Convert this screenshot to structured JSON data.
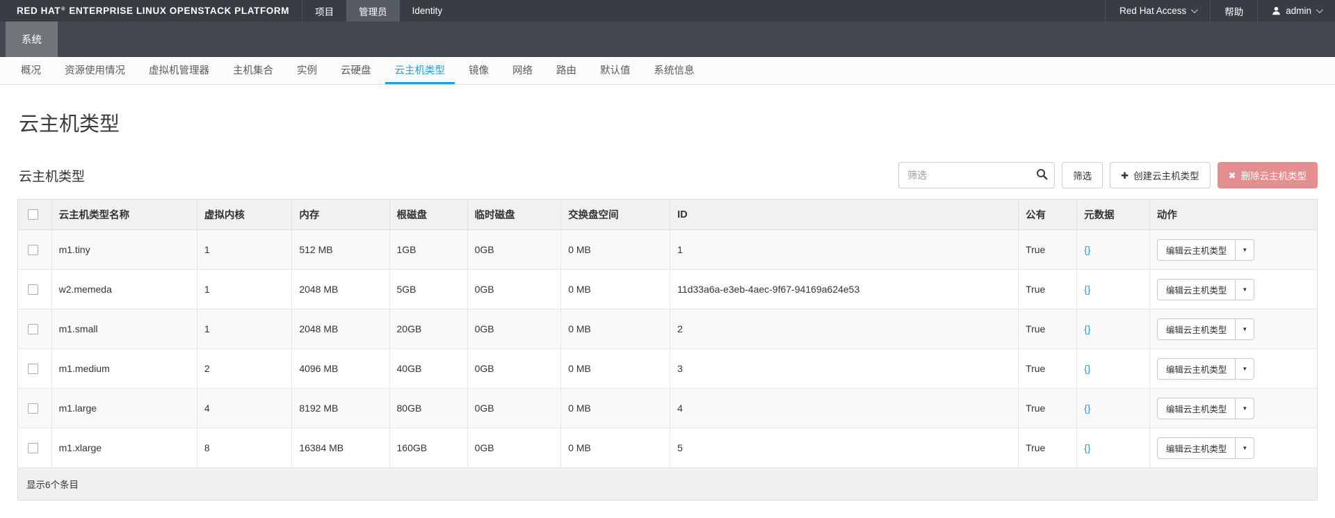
{
  "navbar": {
    "brand": {
      "name": "RED HAT",
      "reg": "®",
      "suffix": "ENTERPRISE LINUX OPENSTACK PLATFORM"
    },
    "tabs": [
      {
        "label": "项目",
        "active": false
      },
      {
        "label": "管理员",
        "active": true
      },
      {
        "label": "Identity",
        "active": false
      }
    ],
    "right": {
      "access_label": "Red Hat Access",
      "help_label": "帮助",
      "user_label": "admin"
    }
  },
  "context_bar": {
    "tab_label": "系统"
  },
  "subtabs": {
    "items": [
      "概况",
      "资源使用情况",
      "虚拟机管理器",
      "主机集合",
      "实例",
      "云硬盘",
      "云主机类型",
      "镜像",
      "网络",
      "路由",
      "默认值",
      "系统信息"
    ],
    "active_index": 6
  },
  "page": {
    "title": "云主机类型"
  },
  "toolbar": {
    "section_title": "云主机类型",
    "filter_placeholder": "筛选",
    "filter_value": "",
    "filter_button_label": "筛选",
    "create_button_label": "创建云主机类型",
    "delete_button_label": "删除云主机类型"
  },
  "icons": {
    "plus": "✚",
    "close": "✖",
    "caret_down": "▼",
    "search": "magnifier",
    "user": "person-silhouette"
  },
  "table": {
    "headers": [
      "云主机类型名称",
      "虚拟内核",
      "内存",
      "根磁盘",
      "临时磁盘",
      "交换盘空间",
      "ID",
      "公有",
      "元数据",
      "动作"
    ],
    "rows": [
      {
        "name": "m1.tiny",
        "vcpus": "1",
        "ram": "512 MB",
        "root_disk": "1GB",
        "ephemeral_disk": "0GB",
        "swap": "0 MB",
        "id": "1",
        "public": "True",
        "metadata": "{}",
        "action": "编辑云主机类型"
      },
      {
        "name": "w2.memeda",
        "vcpus": "1",
        "ram": "2048 MB",
        "root_disk": "5GB",
        "ephemeral_disk": "0GB",
        "swap": "0 MB",
        "id": "11d33a6a-e3eb-4aec-9f67-94169a624e53",
        "public": "True",
        "metadata": "{}",
        "action": "编辑云主机类型"
      },
      {
        "name": "m1.small",
        "vcpus": "1",
        "ram": "2048 MB",
        "root_disk": "20GB",
        "ephemeral_disk": "0GB",
        "swap": "0 MB",
        "id": "2",
        "public": "True",
        "metadata": "{}",
        "action": "编辑云主机类型"
      },
      {
        "name": "m1.medium",
        "vcpus": "2",
        "ram": "4096 MB",
        "root_disk": "40GB",
        "ephemeral_disk": "0GB",
        "swap": "0 MB",
        "id": "3",
        "public": "True",
        "metadata": "{}",
        "action": "编辑云主机类型"
      },
      {
        "name": "m1.large",
        "vcpus": "4",
        "ram": "8192 MB",
        "root_disk": "80GB",
        "ephemeral_disk": "0GB",
        "swap": "0 MB",
        "id": "4",
        "public": "True",
        "metadata": "{}",
        "action": "编辑云主机类型"
      },
      {
        "name": "m1.xlarge",
        "vcpus": "8",
        "ram": "16384 MB",
        "root_disk": "160GB",
        "ephemeral_disk": "0GB",
        "swap": "0 MB",
        "id": "5",
        "public": "True",
        "metadata": "{}",
        "action": "编辑云主机类型"
      }
    ],
    "footer_text": "显示6个条目"
  },
  "colors": {
    "accent": "#1ba1d9",
    "danger_button": "#e48f8f",
    "link": "#1b9bd7",
    "navbar": "#383d43"
  }
}
